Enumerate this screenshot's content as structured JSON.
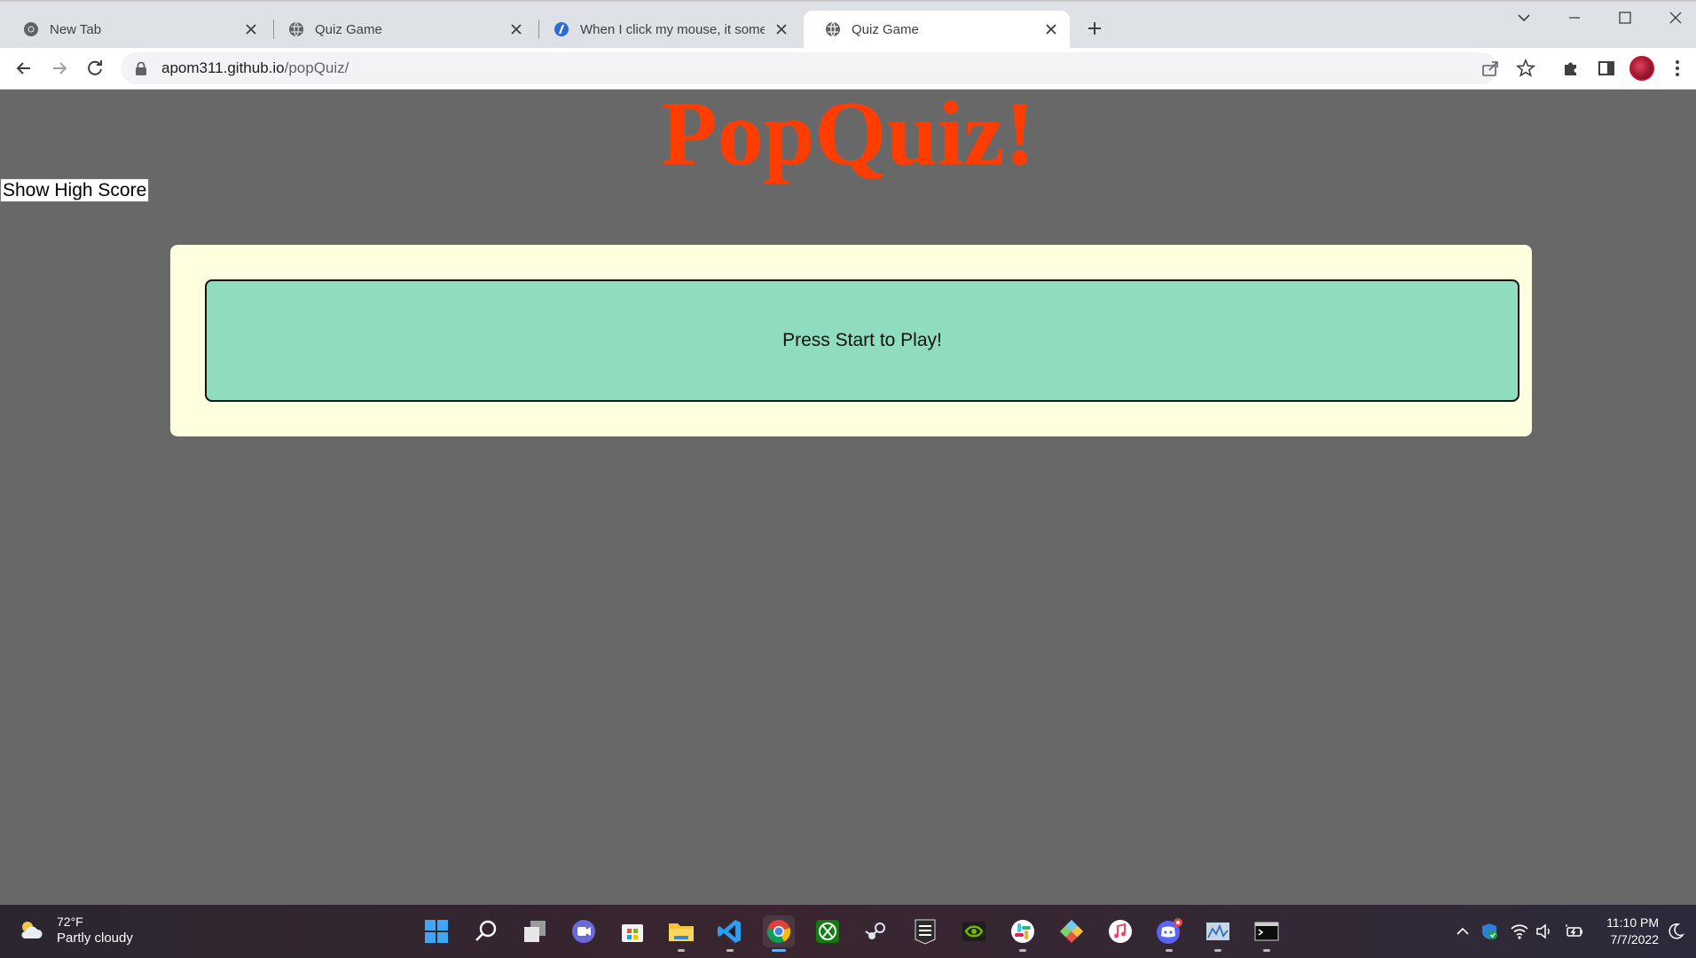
{
  "browser": {
    "tabs": [
      {
        "title": "New Tab",
        "icon": "chrome-icon"
      },
      {
        "title": "Quiz Game",
        "icon": "globe-icon"
      },
      {
        "title": "When I click my mouse, it someti",
        "icon": "answers-icon"
      },
      {
        "title": "Quiz Game",
        "icon": "globe-icon",
        "active": true
      }
    ],
    "url_host": "apom311.github.io",
    "url_path": "/popQuiz/"
  },
  "page": {
    "title": "PopQuiz!",
    "high_score_button": "Show High Score",
    "prompt": "Press Start to Play!"
  },
  "colors": {
    "page_background": "#686868",
    "title": "#ff3d00",
    "card": "#ffffe0",
    "prompt_box": "#8fdcbf"
  },
  "taskbar": {
    "weather_temp": "72°F",
    "weather_condition": "Partly cloudy",
    "time": "11:10 PM",
    "date": "7/7/2022",
    "apps": [
      "windows-start",
      "search",
      "task-view",
      "teams-chat",
      "microsoft-store",
      "file-explorer",
      "vscode",
      "chrome",
      "xbox",
      "steam",
      "epic-games",
      "nvidia",
      "slack",
      "git-app",
      "itunes",
      "discord",
      "resource-monitor",
      "terminal"
    ],
    "tray": [
      "show-hidden",
      "defender",
      "wifi",
      "volume",
      "battery",
      "night-light"
    ]
  }
}
